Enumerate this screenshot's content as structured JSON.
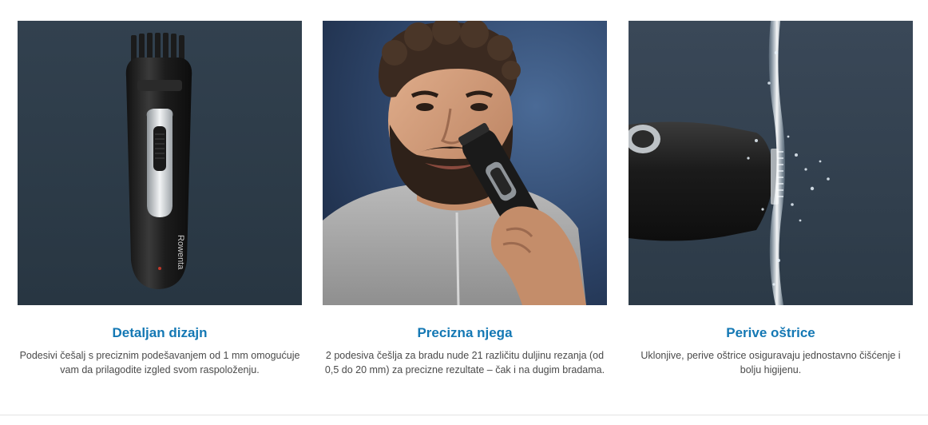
{
  "features": [
    {
      "image_alt": "trimmer-icon",
      "title": "Detaljan dizajn",
      "description": "Podesivi češalj s preciznim podešavanjem od 1 mm omogućuje vam da prilagodite izgled svom raspoloženju.",
      "brand_text": "Rowenta"
    },
    {
      "image_alt": "man-trimming-beard-photo",
      "title": "Precizna njega",
      "description": "2 podesiva češlja za bradu nude 21 različitu duljinu rezanja (od 0,5 do 20 mm) za precizne rezultate – čak i na dugim bradama."
    },
    {
      "image_alt": "washable-blades-photo",
      "title": "Perive oštrice",
      "description": "Uklonjive, perive oštrice osiguravaju jednostavno čišćenje i bolju higijenu."
    }
  ],
  "colors": {
    "title": "#1478b4",
    "text": "#4a4a4a",
    "image_bg": "#2c3a47"
  }
}
